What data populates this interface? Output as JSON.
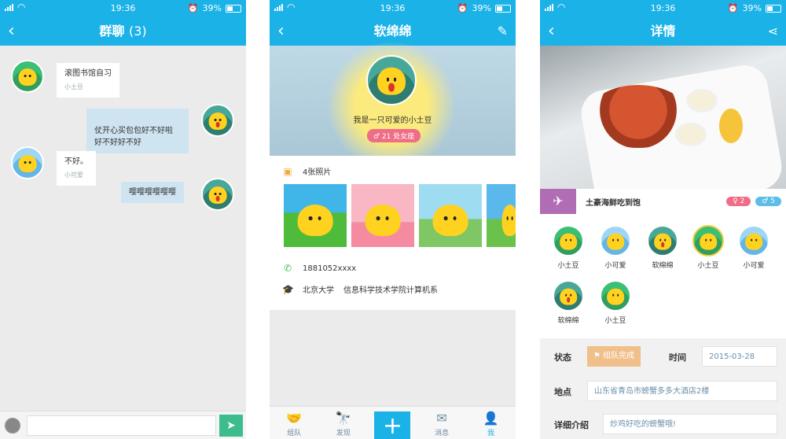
{
  "status": {
    "time": "19:36",
    "battery": "39%"
  },
  "chat": {
    "title": "群聊",
    "count": "(3)",
    "messages": [
      {
        "text": "滚图书馆自习",
        "name": "小土豆"
      },
      {
        "text": "仗开心买包包好不好啦\n好不好好不好"
      },
      {
        "text": "不好。",
        "name": "小可爱"
      },
      {
        "text": "嘤嘤嘤嘤嘤嘤"
      }
    ]
  },
  "profile": {
    "title": "软绵绵",
    "tagline": "我是一只可爱的小土豆",
    "age": "♂ 21 处女座",
    "photos_label": "4张照片",
    "phone": "1881052xxxx",
    "school": "北京大学",
    "department": "信息科学技术学院计算机系",
    "tabs": [
      "组队",
      "发现",
      "消息",
      "我"
    ]
  },
  "detail": {
    "title": "详情",
    "event": "土豪海鲜吃到饱",
    "female": "♀ 2",
    "male": "♂ 5",
    "members": [
      "小土豆",
      "小可爱",
      "软绵绵",
      "小土豆",
      "小可爱",
      "软绵绵",
      "小土豆"
    ],
    "status_label": "状态",
    "status_value": "组队完成",
    "time_label": "时间",
    "time_value": "2015-03-28",
    "place_label": "地点",
    "place_value": "山东省青岛市螃蟹多多大酒店2楼",
    "desc_label": "详细介绍",
    "desc_value": "炒鸡好吃的螃蟹哦!"
  },
  "colors": {
    "accent": "#1bb2e8",
    "female": "#ef6d87",
    "male": "#5bbde8",
    "event_icon": "#b06db3"
  }
}
